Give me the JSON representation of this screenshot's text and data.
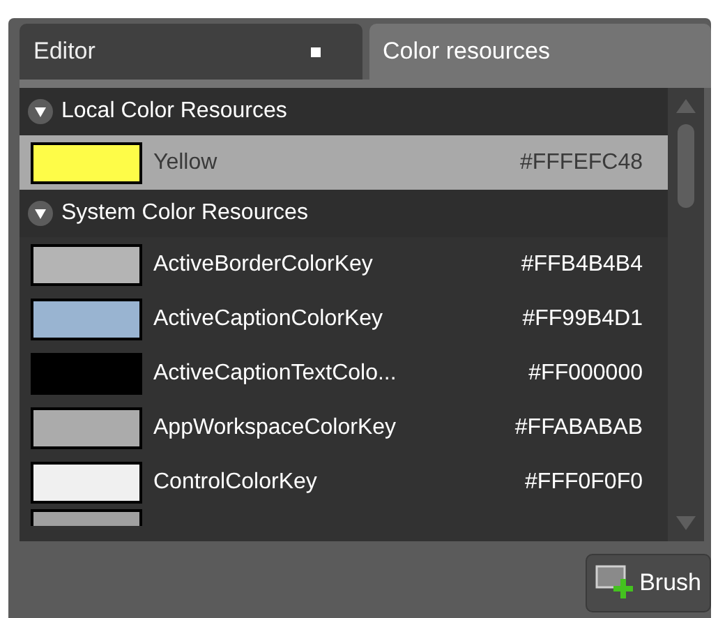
{
  "tabs": [
    {
      "label": "Editor",
      "selected": false,
      "pinned": true
    },
    {
      "label": "Color resources",
      "selected": true
    }
  ],
  "groups": [
    {
      "title": "Local Color Resources",
      "expanded": true,
      "items": [
        {
          "name": "Yellow",
          "value": "#FFFEFC48",
          "color": "#fefc48",
          "selected": true
        }
      ]
    },
    {
      "title": "System Color Resources",
      "expanded": true,
      "items": [
        {
          "name": "ActiveBorderColorKey",
          "value": "#FFB4B4B4",
          "color": "#b4b4b4",
          "selected": false
        },
        {
          "name": "ActiveCaptionColorKey",
          "value": "#FF99B4D1",
          "color": "#99b4d1",
          "selected": false
        },
        {
          "name": "ActiveCaptionTextColo...",
          "value": "#FF000000",
          "color": "#000000",
          "selected": false
        },
        {
          "name": "AppWorkspaceColorKey",
          "value": "#FFABABAB",
          "color": "#ababab",
          "selected": false
        },
        {
          "name": "ControlColorKey",
          "value": "#FFF0F0F0",
          "color": "#f0f0f0",
          "selected": false
        },
        {
          "color": "#a0a0a0",
          "selected": false
        }
      ]
    }
  ],
  "brush_button": {
    "label": "Brush"
  }
}
